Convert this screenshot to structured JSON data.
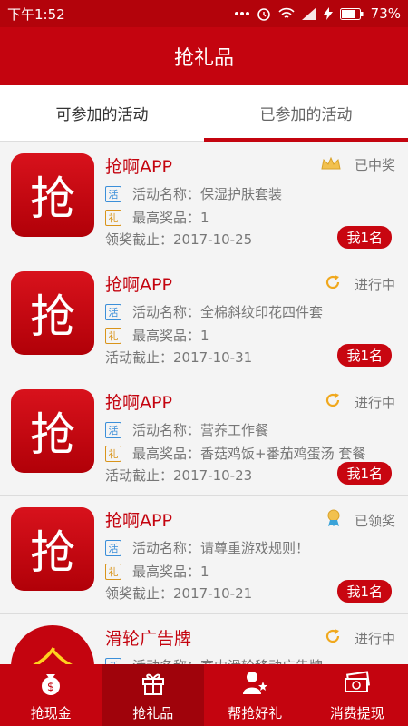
{
  "status_bar": {
    "time": "下午1:52",
    "battery": "73%"
  },
  "header": {
    "title": "抢礼品"
  },
  "tabs": [
    {
      "label": "可参加的活动"
    },
    {
      "label": "已参加的活动"
    }
  ],
  "items": [
    {
      "logo_char": "抢",
      "title": "抢啊APP",
      "status": "已中奖",
      "status_icon": "crown-icon",
      "tag1": "活",
      "line1": "活动名称：保湿护肤套装",
      "tag2": "礼",
      "line2": "最高奖品：1",
      "line3": "领奖截止：2017-10-25",
      "rank": "我1名"
    },
    {
      "logo_char": "抢",
      "title": "抢啊APP",
      "status": "进行中",
      "status_icon": "refresh-icon",
      "tag1": "活",
      "line1": "活动名称：全棉斜纹印花四件套",
      "tag2": "礼",
      "line2": "最高奖品：1",
      "line3": "活动截止：2017-10-31",
      "rank": "我1名"
    },
    {
      "logo_char": "抢",
      "title": "抢啊APP",
      "status": "进行中",
      "status_icon": "refresh-icon",
      "tag1": "活",
      "line1": "活动名称：营养工作餐",
      "tag2": "礼",
      "line2": "最高奖品：香菇鸡饭+番茄鸡蛋汤 套餐",
      "line3": "活动截止：2017-10-23",
      "rank": "我1名"
    },
    {
      "logo_char": "抢",
      "title": "抢啊APP",
      "status": "已领奖",
      "status_icon": "medal-icon",
      "tag1": "活",
      "line1": "活动名称：请尊重游戏规则！",
      "tag2": "礼",
      "line2": "最高奖品：1",
      "line3": "领奖截止：2017-10-21",
      "rank": "我1名"
    },
    {
      "logo_char": "全",
      "title": "滑轮广告牌",
      "status": "进行中",
      "status_icon": "refresh-icon",
      "tag1": "活",
      "line1": "活动名称：室内滑轮移动广告牌",
      "tag2": "",
      "line2": "",
      "line3": "",
      "rank": ""
    }
  ],
  "bottom_nav": [
    {
      "label": "抢现金",
      "icon": "money-bag-icon"
    },
    {
      "label": "抢礼品",
      "icon": "gift-icon"
    },
    {
      "label": "帮抢好礼",
      "icon": "user-star-icon"
    },
    {
      "label": "消费提现",
      "icon": "cash-icon"
    }
  ]
}
